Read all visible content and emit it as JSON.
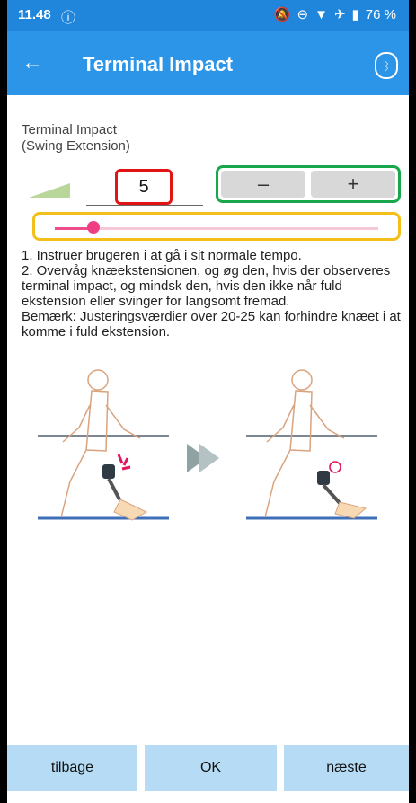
{
  "status": {
    "time": "11.48",
    "battery": "76 %"
  },
  "appbar": {
    "title": "Terminal Impact"
  },
  "setting": {
    "label_line1": "Terminal Impact",
    "label_line2": "(Swing Extension)",
    "value": "5",
    "minus_label": "–",
    "plus_label": "+",
    "slider_level_fraction": 0.12
  },
  "instructions": {
    "line1": "1. Instruer brugeren i at gå i sit normale tempo.",
    "line2": "2. Overvåg knæekstensionen, og øg den, hvis der observeres terminal impact, og mindsk den, hvis den ikke når fuld ekstension eller svinger for langsomt fremad.",
    "line3": "Bemærk: Justeringsværdier over 20-25 kan forhindre knæet i at komme i fuld ekstension."
  },
  "bottom_nav": {
    "back_label": "tilbage",
    "ok_label": "OK",
    "next_label": "næste"
  },
  "colors": {
    "appbar": "#2d95e8",
    "value_box": "#e21414",
    "stepper_box": "#18a84b",
    "slider_box": "#f3bf1a",
    "slider_thumb": "#ef3f82",
    "nav_button": "#b6dcf5"
  }
}
